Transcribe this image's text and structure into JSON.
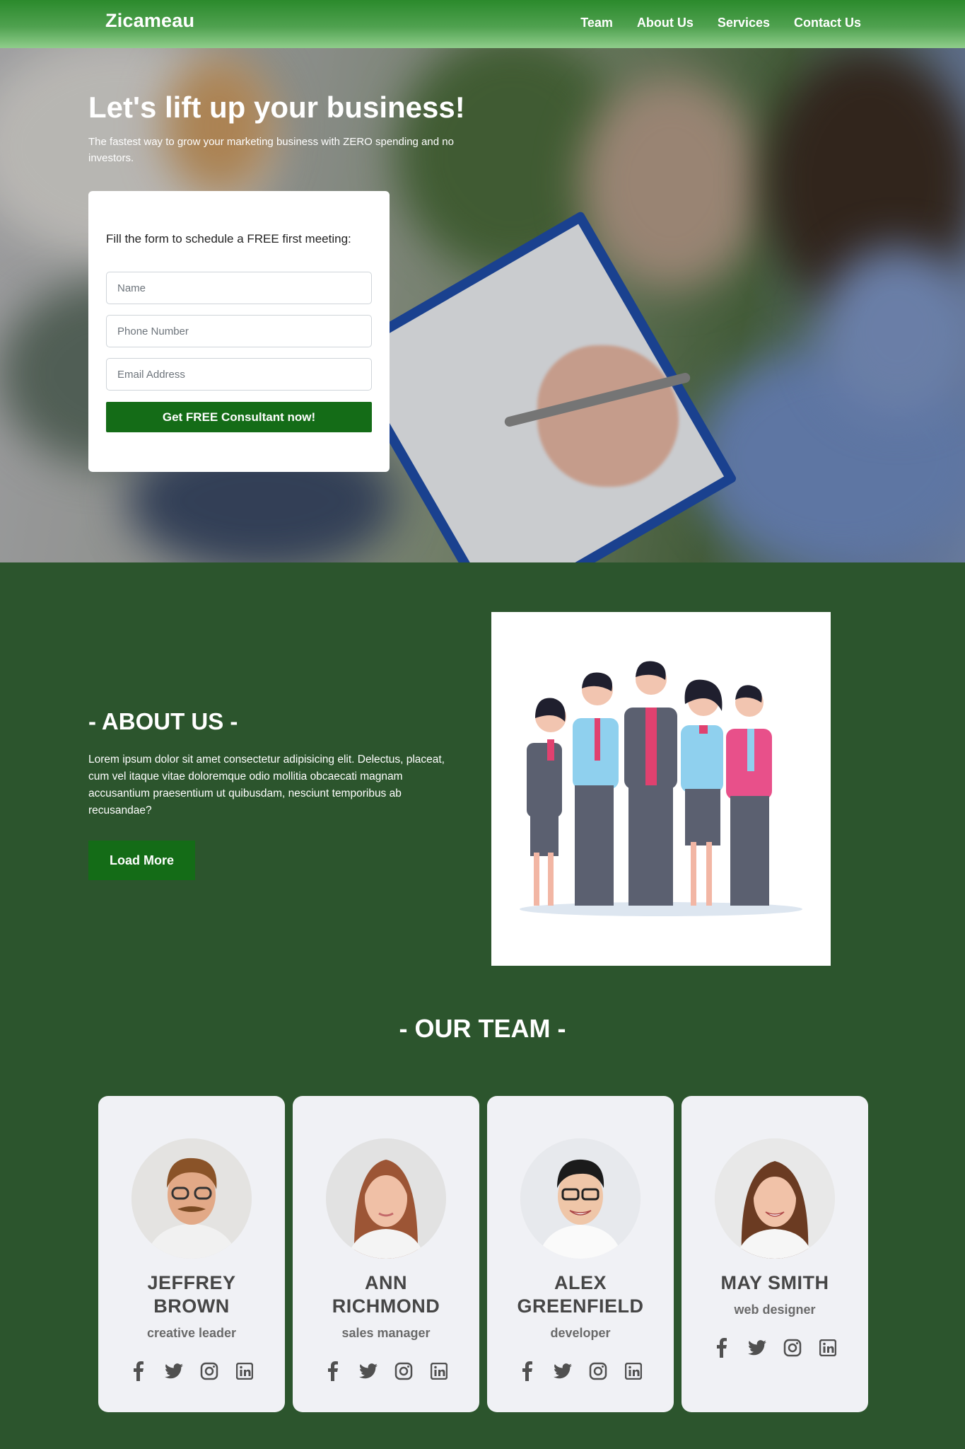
{
  "nav": {
    "brand": "Zicameau",
    "links": [
      "Team",
      "About Us",
      "Services",
      "Contact Us"
    ]
  },
  "hero": {
    "title": "Let's lift up your business!",
    "subtitle": "The fastest way to grow your marketing business with ZERO spending and no investors."
  },
  "form": {
    "title": "Fill the form to schedule a FREE first meeting:",
    "name_placeholder": "Name",
    "phone_placeholder": "Phone Number",
    "email_placeholder": "Email Address",
    "submit_label": "Get FREE Consultant now!"
  },
  "about": {
    "title": "- ABOUT US -",
    "text": "Lorem ipsum dolor sit amet consectetur adipisicing elit. Delectus, placeat, cum vel itaque vitae doloremque odio mollitia obcaecati magnam accusantium praesentium ut quibusdam, nesciunt temporibus ab recusandae?",
    "button_label": "Load More"
  },
  "team": {
    "title": "- OUR TEAM -",
    "members": [
      {
        "name": "JEFFREY BROWN",
        "role": "creative leader"
      },
      {
        "name": "ANN RICHMOND",
        "role": "sales manager"
      },
      {
        "name": "ALEX GREENFIELD",
        "role": "developer"
      },
      {
        "name": "MAY SMITH",
        "role": "web designer"
      }
    ],
    "social_icons": [
      "facebook-icon",
      "twitter-icon",
      "instagram-icon",
      "linkedin-icon"
    ]
  },
  "colors": {
    "nav_green": "#2b8a2c",
    "page_green": "#2c552d",
    "button_green": "#146c17",
    "card_bg": "#f0f1f5"
  }
}
